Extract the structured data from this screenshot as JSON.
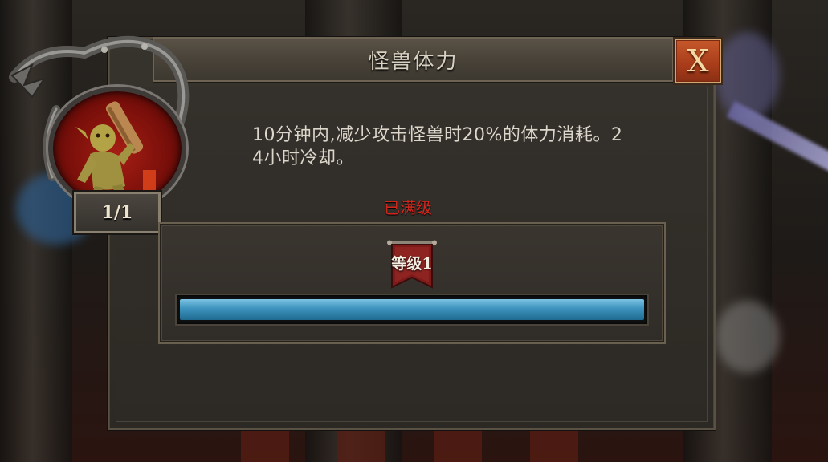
{
  "dialog": {
    "title": "怪兽体力",
    "close_label": "X"
  },
  "monster": {
    "level_count": "1/1",
    "portrait_icon": "goblin-club-icon"
  },
  "skill": {
    "description_line1": "10分钟内,减少攻击怪兽时20%的体力消耗。2",
    "description_line2": "4小时冷却。",
    "status": "已满级",
    "level_label": "等级1",
    "progress": 1.0
  },
  "colors": {
    "status_red": "#d2261c",
    "progress_blue": "#3d93bd",
    "close_orange": "#b8471f"
  }
}
